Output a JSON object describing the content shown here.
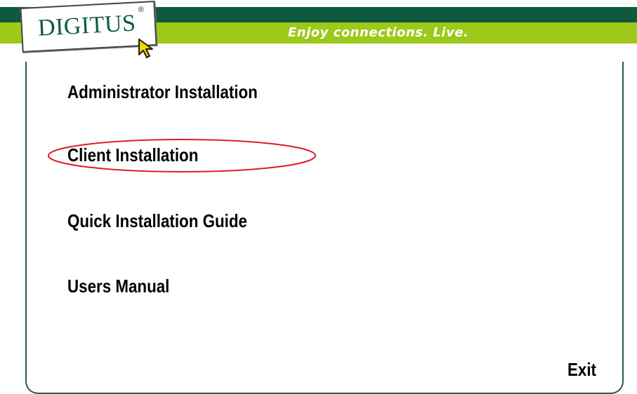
{
  "header": {
    "brand": "DIGITUS",
    "registered_mark": "®",
    "tagline": "Enjoy connections. Live."
  },
  "menu": {
    "items": [
      {
        "label": "Administrator Installation"
      },
      {
        "label": "Client Installation",
        "highlighted": true
      },
      {
        "label": "Quick Installation Guide"
      },
      {
        "label": "Users Manual"
      }
    ],
    "exit_label": "Exit"
  },
  "icons": {
    "logo_cursor": "cursor-arrow-icon",
    "highlight": "red-ellipse-annotation"
  },
  "colors": {
    "header_dark": "#0f5a3c",
    "header_green": "#9ec81a",
    "frame": "#2d5e3f",
    "highlight": "#e01b24",
    "cursor_fill": "#f2d600"
  }
}
